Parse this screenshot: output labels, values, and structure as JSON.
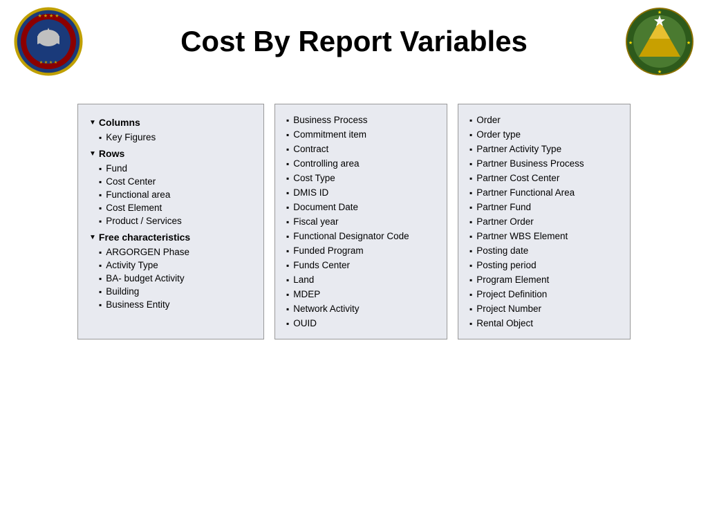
{
  "header": {
    "title": "Cost By Report Variables"
  },
  "left_panel": {
    "sections": [
      {
        "name": "Columns",
        "items": [
          "Key Figures"
        ]
      },
      {
        "name": "Rows",
        "items": [
          "Fund",
          "Cost Center",
          "Functional area",
          "Cost Element",
          "Product / Services"
        ]
      },
      {
        "name": "Free characteristics",
        "items": [
          "ARGORGEN Phase",
          "Activity Type",
          "BA- budget Activity",
          "Building",
          "Business Entity"
        ]
      }
    ]
  },
  "middle_panel": {
    "items": [
      "Business Process",
      "Commitment item",
      "Contract",
      "Controlling area",
      "Cost Type",
      "DMIS ID",
      "Document Date",
      "Fiscal year",
      "Functional Designator Code",
      "Funded Program",
      "Funds Center",
      "Land",
      "MDEP",
      "Network Activity",
      "OUID"
    ]
  },
  "right_panel": {
    "items": [
      "Order",
      "Order type",
      "Partner Activity Type",
      "Partner Business Process",
      "Partner Cost Center",
      "Partner Functional Area",
      "Partner Fund",
      "Partner Order",
      "Partner WBS Element",
      "Posting date",
      "Posting period",
      "Program Element",
      "Project Definition",
      "Project Number",
      "Rental Object"
    ]
  }
}
